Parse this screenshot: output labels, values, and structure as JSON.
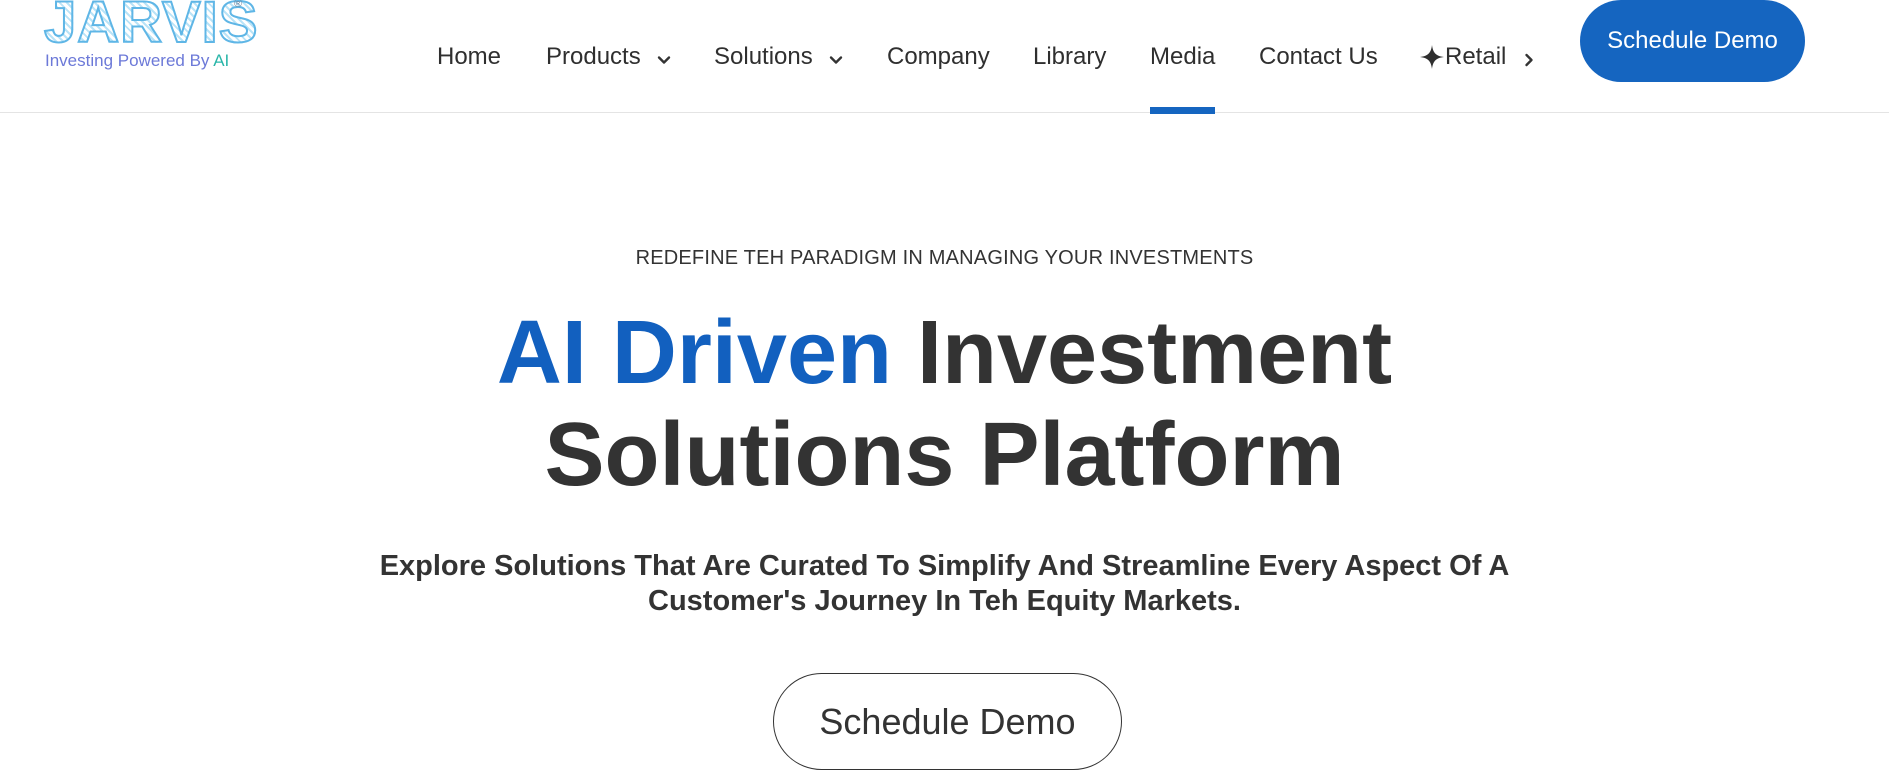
{
  "logo": {
    "wordmark": "JARVIS",
    "registered": "®",
    "tagline_prefix": "Investing Powered By ",
    "tagline_ai": "AI"
  },
  "nav": {
    "items": [
      {
        "label": "Home"
      },
      {
        "label": "Products"
      },
      {
        "label": "Solutions"
      },
      {
        "label": "Company"
      },
      {
        "label": "Library"
      },
      {
        "label": "Media"
      },
      {
        "label": "Contact Us"
      },
      {
        "label": "Retail"
      }
    ],
    "active": "Media",
    "cta_label": "Schedule Demo"
  },
  "hero": {
    "eyebrow": "REDEFINE TEH PARADIGM IN MANAGING YOUR INVESTMENTS",
    "headline_accent": "AI Driven",
    "headline_rest_line1": " Investment",
    "headline_line2": "Solutions Platform",
    "subhead_line1": "Explore Solutions That Are Curated To Simplify And Streamline Every Aspect Of A",
    "subhead_line2": "Customer's Journey In Teh Equity Markets.",
    "cta_label": "Schedule Demo"
  },
  "colors": {
    "brand_blue": "#1565c0",
    "headline_accent": "#1260bf",
    "text_dark": "#333333"
  }
}
